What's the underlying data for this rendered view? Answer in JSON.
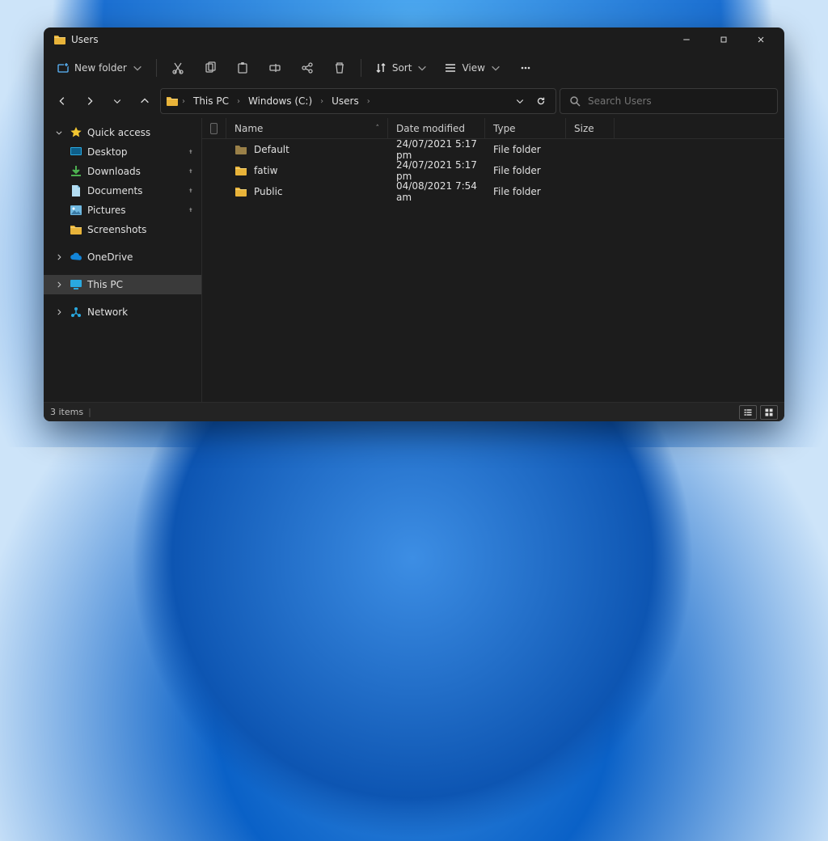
{
  "window": {
    "title": "Users"
  },
  "toolbar": {
    "new_label": "New folder",
    "sort_label": "Sort",
    "view_label": "View"
  },
  "nav": {
    "breadcrumb": [
      "This PC",
      "Windows (C:)",
      "Users"
    ],
    "search_placeholder": "Search Users"
  },
  "sidebar": {
    "quick_access": {
      "label": "Quick access"
    },
    "quick_items": [
      {
        "label": "Desktop",
        "icon": "desktop",
        "pinned": true
      },
      {
        "label": "Downloads",
        "icon": "download",
        "pinned": true
      },
      {
        "label": "Documents",
        "icon": "document",
        "pinned": true
      },
      {
        "label": "Pictures",
        "icon": "picture",
        "pinned": true
      },
      {
        "label": "Screenshots",
        "icon": "folder",
        "pinned": false
      }
    ],
    "onedrive": {
      "label": "OneDrive"
    },
    "this_pc": {
      "label": "This PC"
    },
    "network": {
      "label": "Network"
    }
  },
  "columns": {
    "name": "Name",
    "date": "Date modified",
    "type": "Type",
    "size": "Size"
  },
  "files": [
    {
      "name": "Default",
      "date": "24/07/2021 5:17 pm",
      "type": "File folder",
      "icon": "folder-dim"
    },
    {
      "name": "fatiw",
      "date": "24/07/2021 5:17 pm",
      "type": "File folder",
      "icon": "folder"
    },
    {
      "name": "Public",
      "date": "04/08/2021 7:54 am",
      "type": "File folder",
      "icon": "folder"
    }
  ],
  "status": {
    "text": "3 items"
  }
}
